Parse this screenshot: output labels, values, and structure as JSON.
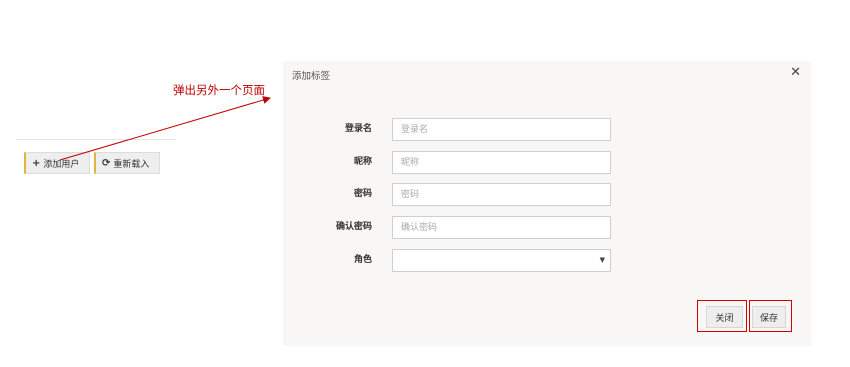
{
  "toolbar": {
    "add_user_label": "添加用户",
    "reload_label": "重新载入",
    "add_icon": "plus-icon",
    "reload_icon": "refresh-icon"
  },
  "annotation": {
    "text": "弹出另外一个页面",
    "color": "#c00000"
  },
  "dialog": {
    "title": "添加标签",
    "close_icon": "close-icon",
    "fields": [
      {
        "label": "登录名",
        "placeholder": "登录名",
        "value": ""
      },
      {
        "label": "昵称",
        "placeholder": "昵称",
        "value": ""
      },
      {
        "label": "密码",
        "placeholder": "密码",
        "value": ""
      },
      {
        "label": "确认密码",
        "placeholder": "确认密码",
        "value": ""
      },
      {
        "label": "角色",
        "value": ""
      }
    ],
    "close_button_label": "关闭",
    "save_button_label": "保存"
  }
}
